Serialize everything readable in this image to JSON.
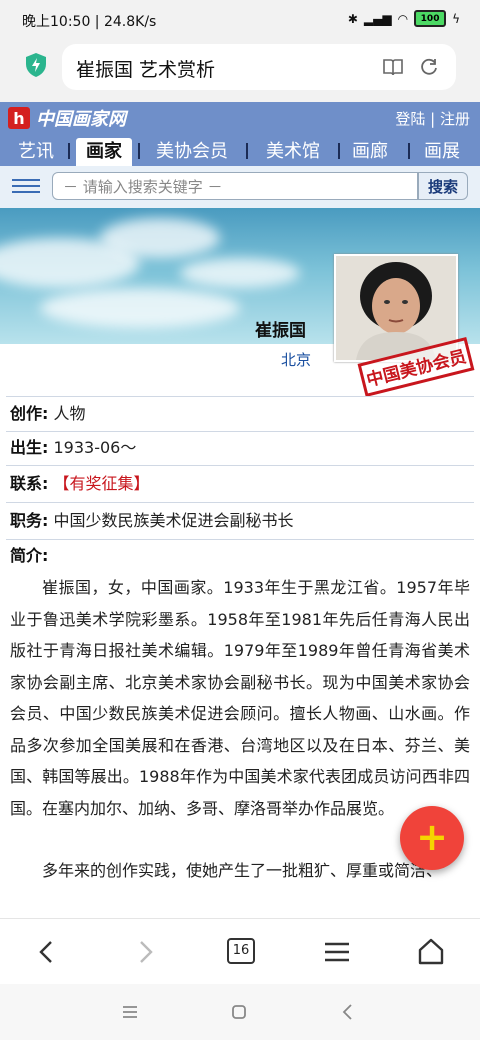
{
  "status": {
    "time": "晚上10:50 | 24.8K/s",
    "battery": "100"
  },
  "browser": {
    "address_title": "崔振国 艺术赏析",
    "tab_count": "16"
  },
  "site": {
    "logo": "中国画家网",
    "login": "登陆 | 注册",
    "nav": [
      "艺讯",
      "画家",
      "美协会员",
      "美术馆",
      "画廊",
      "画展"
    ],
    "active_nav": "画家",
    "search_placeholder": "－ 请输入搜索关键字 －",
    "search_button": "搜索"
  },
  "profile": {
    "name": "崔振国",
    "location": "北京",
    "stamp": "中国美协会员",
    "rows": [
      {
        "key": "创作:",
        "value": "人物"
      },
      {
        "key": "出生:",
        "value": "1933-06～"
      },
      {
        "key": "联系:",
        "value": "【有奖征集】"
      },
      {
        "key": "职务:",
        "value": "中国少数民族美术促进会副秘书长"
      }
    ],
    "intro_label": "简介:",
    "intro_p1": "崔振国，女，中国画家。1933年生于黑龙江省。1957年毕业于鲁迅美术学院彩墨系。1958年至1981年先后任青海人民出版社于青海日报社美术编辑。1979年至1989年曾任青海省美术家协会副主席、北京美术家协会副秘书长。现为中国美术家协会会员、中国少数民族美术促进会顾问。擅长人物画、山水画。作品多次参加全国美展和在香港、台湾地区以及在日本、芬兰、美国、韩国等展出。1988年作为中国美术家代表团成员访问西非四国。在塞内加尔、加纳、多哥、摩洛哥举办作品展览。",
    "intro_p2": "多年来的创作实践，使她产生了一批粗犷、厚重或简洁、"
  },
  "fab": {
    "label": "+"
  }
}
